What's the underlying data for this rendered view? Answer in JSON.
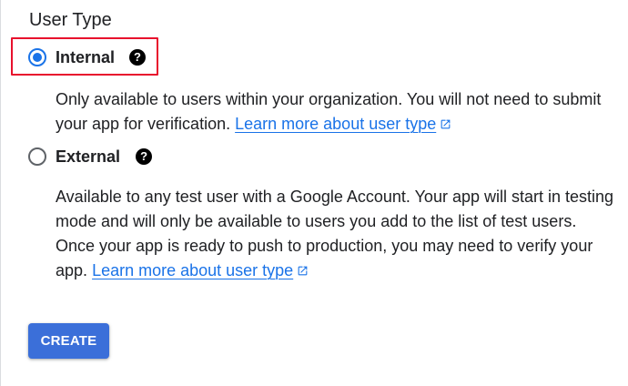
{
  "section": {
    "title": "User Type"
  },
  "options": {
    "internal": {
      "label": "Internal",
      "selected": true,
      "help_icon": "question-circle-icon",
      "help_glyph": "?",
      "description": "Only available to users within your organization. You will not need to submit your app for verification.",
      "link_text": "Learn more about user type",
      "link_icon": "open-in-new-icon"
    },
    "external": {
      "label": "External",
      "selected": false,
      "help_icon": "question-circle-icon",
      "help_glyph": "?",
      "description": "Available to any test user with a Google Account. Your app will start in testing mode and will only be available to users you add to the list of test users. Once your app is ready to push to production, you may need to verify your app.",
      "link_text": "Learn more about user type",
      "link_icon": "open-in-new-icon"
    }
  },
  "actions": {
    "create_label": "CREATE"
  },
  "colors": {
    "accent": "#1a73e8",
    "button": "#3b6fd9",
    "highlight_border": "#e8112d",
    "text": "#202124"
  }
}
